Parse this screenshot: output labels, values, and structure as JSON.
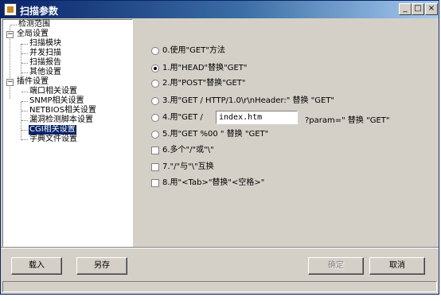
{
  "window": {
    "title": "扫描参数"
  },
  "titlebar_buttons": {
    "minimize": "_",
    "maximize": "□",
    "close": "×"
  },
  "tree": {
    "items": [
      {
        "label": "检测范围",
        "level": 1
      },
      {
        "label": "全局设置",
        "level": 0,
        "expander": "−"
      },
      {
        "label": "扫描模块",
        "level": 1
      },
      {
        "label": "并发扫描",
        "level": 1
      },
      {
        "label": "扫描报告",
        "level": 1
      },
      {
        "label": "其他设置",
        "level": 1
      },
      {
        "label": "插件设置",
        "level": 0,
        "expander": "−"
      },
      {
        "label": "端口相关设置",
        "level": 1
      },
      {
        "label": "SNMP相关设置",
        "level": 1
      },
      {
        "label": "NETBIOS相关设置",
        "level": 1
      },
      {
        "label": "漏洞检测脚本设置",
        "level": 1
      },
      {
        "label": "CGI相关设置",
        "level": 1,
        "selected": true
      },
      {
        "label": "字典文件设置",
        "level": 1
      }
    ]
  },
  "options": {
    "o0": "0.使用\"GET\"方法",
    "o1": "1.用\"HEAD\"替换\"GET\"",
    "o2": "2.用\"POST\"替换\"GET\"",
    "o3": "3.用\"GET / HTTP/1.0\\r\\nHeader:\" 替换 \"GET\"",
    "o4_prefix": "4.用\"GET /",
    "o4_value": "index.htm",
    "o4_suffix": "?param=\" 替换 \"GET\"",
    "o5": "5.用\"GET %00 \" 替换 \"GET\"",
    "o6": "6.多个\"/\"或\"\\\"",
    "o7": "7.\"/\"与\"\\\"互换",
    "o8": "8.用\"<Tab>\"替换\"<空格>\"",
    "selected_radio": 1
  },
  "buttons": {
    "load": "载入",
    "save": "另存",
    "ok": "确定",
    "cancel": "取消"
  }
}
